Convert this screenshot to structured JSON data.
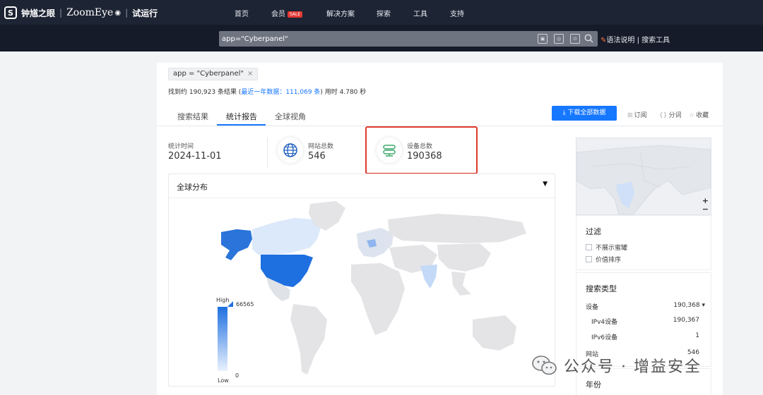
{
  "brand": {
    "name": "钟馗之眼",
    "product": "ZoomEye",
    "trial": "试运行"
  },
  "nav": {
    "items": [
      "首页",
      "会员",
      "解决方案",
      "探索",
      "工具",
      "支持"
    ],
    "sale_badge": "SALE"
  },
  "search": {
    "query": "app=\"Cyberpanel\"",
    "syntax_link": "语法说明",
    "divider": "|",
    "tools_link": "搜索工具"
  },
  "results": {
    "chip": "app = \"Cyberpanel\"",
    "found_prefix": "找到约 190,923 条结果 (",
    "found_recent": "最近一年数据：111,069 条",
    "found_suffix": ") 用时 4.780 秒"
  },
  "tabs": [
    "搜索结果",
    "统计报告",
    "全球视角"
  ],
  "actions": {
    "download": "下载全部数据",
    "subscribe": "订阅",
    "segment": "分词",
    "favorite": "收藏"
  },
  "stats": {
    "time_label": "统计时间",
    "time_value": "2024-11-01",
    "sites_label": "网站总数",
    "sites_value": "546",
    "devices_label": "设备总数",
    "devices_value": "190368"
  },
  "map": {
    "title": "全球分布",
    "legend_high": "High",
    "legend_low": "Low",
    "legend_max": "66565",
    "legend_min": "0"
  },
  "sidebar": {
    "filter_title": "过滤",
    "filters": [
      "不展示蜜罐",
      "价值排序"
    ],
    "search_type_title": "搜索类型",
    "rows": [
      {
        "label": "设备",
        "value": "190,368 ▾"
      },
      {
        "label": "IPv4设备",
        "value": "190,367"
      },
      {
        "label": "IPv6设备",
        "value": "1"
      },
      {
        "label": "网站",
        "value": "546"
      }
    ],
    "year_title": "年份"
  },
  "watermark": {
    "text": "公众号 · 增益安全"
  },
  "colors": {
    "accent": "#1677ff",
    "nav_bg": "#1d2433",
    "highlight": "#e03a2b",
    "map_high": "#1e6fe0"
  }
}
